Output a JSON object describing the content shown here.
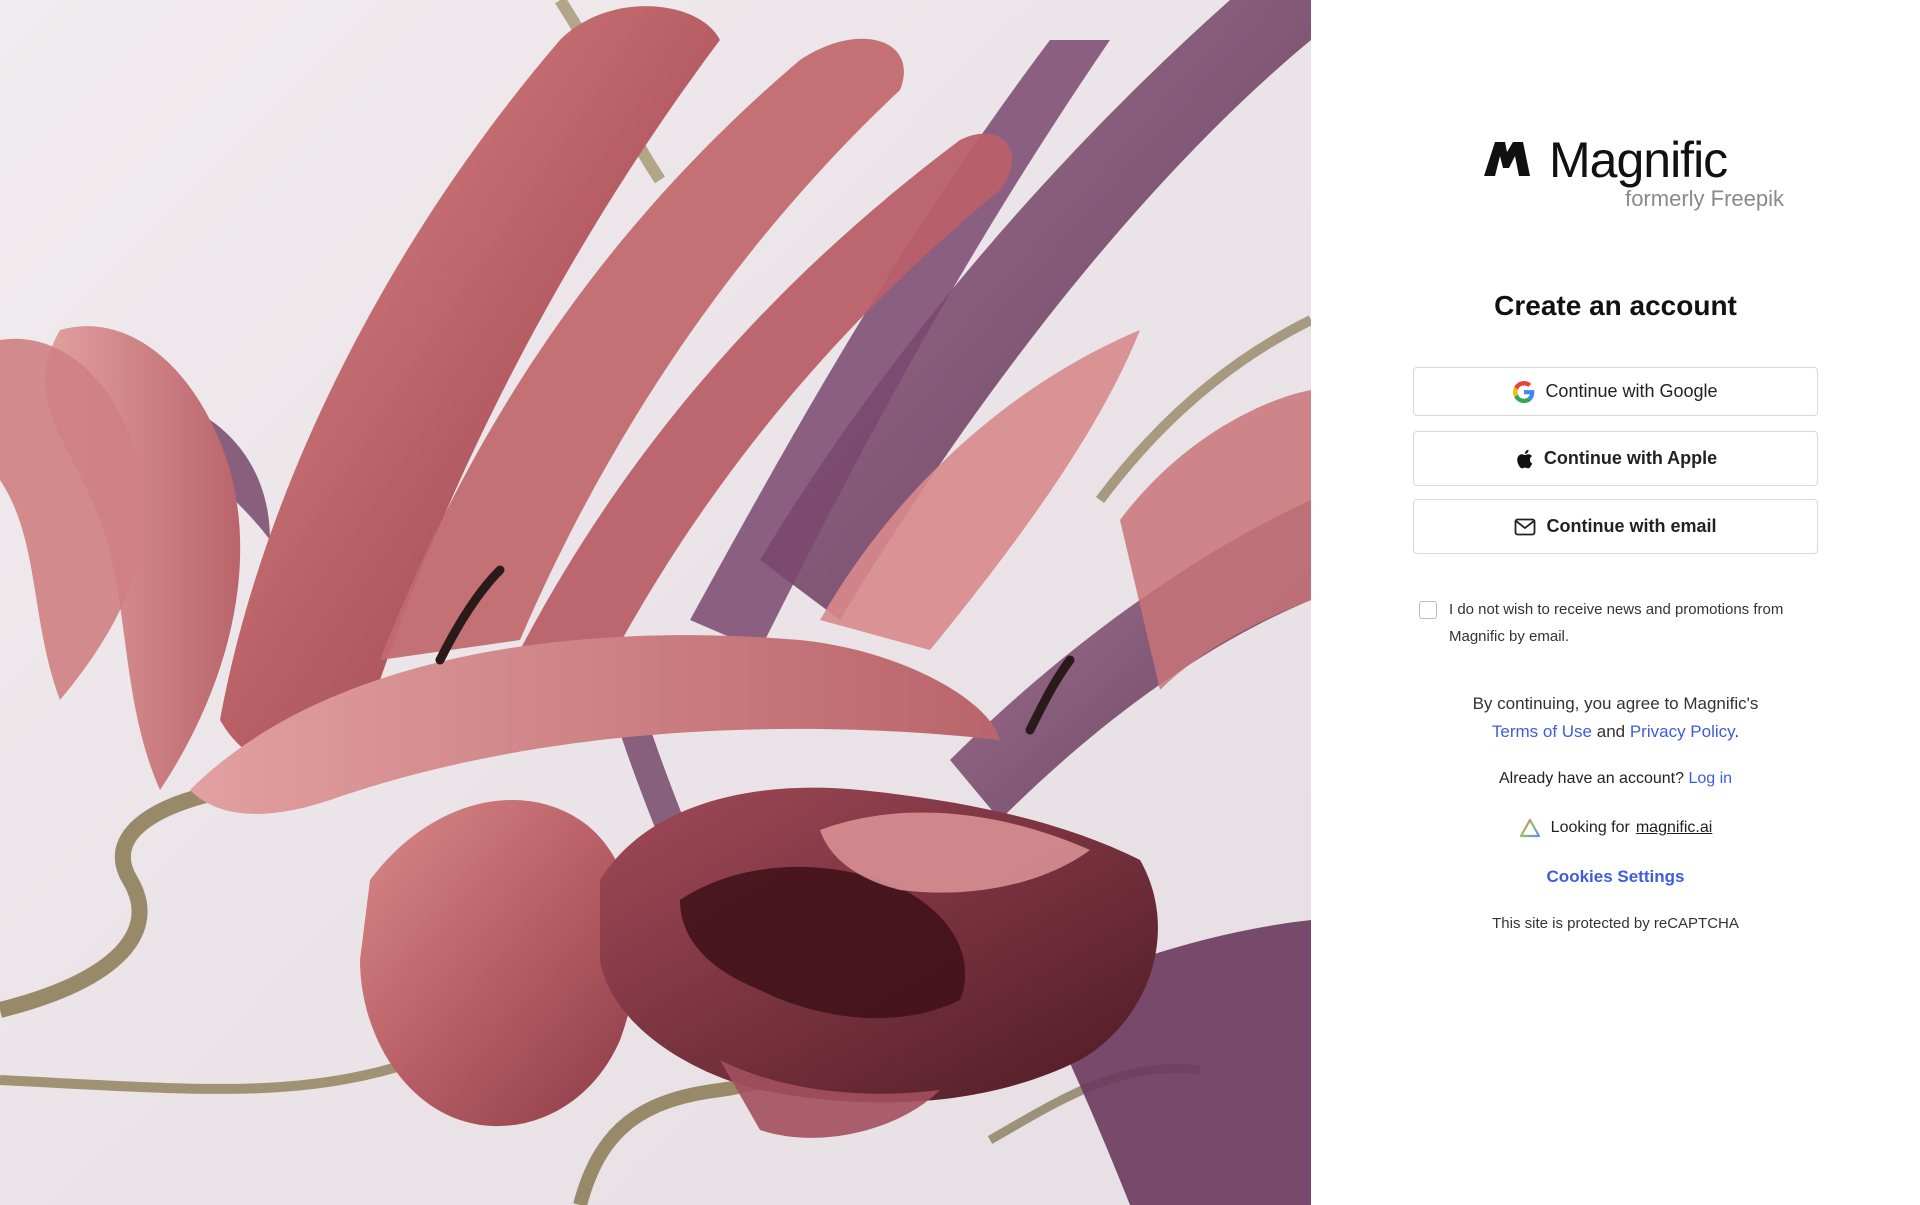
{
  "brand": {
    "name": "Magnific",
    "subtitle": "formerly Freepik"
  },
  "signup": {
    "title": "Create an account",
    "google_label": "Continue with Google",
    "apple_label": "Continue with Apple",
    "email_label": "Continue with email",
    "optout_label": "I do not wish to receive news and promotions from Magnific by email.",
    "optout_checked": false
  },
  "legal": {
    "prefix": "By continuing, you agree to Magnific's",
    "terms_label": "Terms of Use",
    "and": "and",
    "privacy_label": "Privacy Policy",
    "suffix": "."
  },
  "login": {
    "prompt": "Already have an account?",
    "link_label": "Log in"
  },
  "looking": {
    "prefix": "Looking for",
    "link_label": "magnific.ai"
  },
  "cookies_label": "Cookies Settings",
  "recaptcha_text": "This site is protected by reCAPTCHA",
  "colors": {
    "link": "#3d5ce0",
    "petal_pink": "#c46f73",
    "petal_purple": "#6e3f63",
    "stem_olive": "#8a7a52"
  },
  "icons": {
    "brand": "magnific-logo-icon",
    "google": "google-icon",
    "apple": "apple-icon",
    "email": "mail-icon",
    "looking": "triangle-gradient-icon"
  }
}
